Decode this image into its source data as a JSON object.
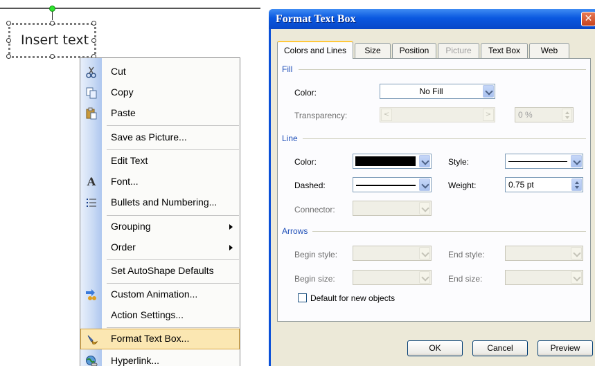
{
  "slide": {
    "textbox_text": "Insert text"
  },
  "context_menu": {
    "items": [
      {
        "label": "Cut",
        "icon": "scissors-icon"
      },
      {
        "label": "Copy",
        "icon": "copy-icon"
      },
      {
        "label": "Paste",
        "icon": "paste-icon"
      },
      {
        "label": "Save as Picture...",
        "icon": ""
      },
      {
        "label": "Edit Text",
        "icon": ""
      },
      {
        "label": "Font...",
        "icon": "font-icon"
      },
      {
        "label": "Bullets and Numbering...",
        "icon": "bullets-icon"
      },
      {
        "label": "Grouping",
        "icon": "",
        "submenu": true
      },
      {
        "label": "Order",
        "icon": "",
        "submenu": true
      },
      {
        "label": "Set AutoShape Defaults",
        "icon": ""
      },
      {
        "label": "Custom Animation...",
        "icon": "animation-icon"
      },
      {
        "label": "Action Settings...",
        "icon": ""
      },
      {
        "label": "Format Text Box...",
        "icon": "format-textbox-icon",
        "highlighted": true
      },
      {
        "label": "Hyperlink...",
        "icon": "hyperlink-icon"
      }
    ],
    "gutter_color": "#c9daf4",
    "highlight_color": "#fbe7b2"
  },
  "dialog": {
    "title": "Format Text Box",
    "close_glyph": "✕",
    "tabs": [
      {
        "label": "Colors and Lines",
        "active": true
      },
      {
        "label": "Size"
      },
      {
        "label": "Position"
      },
      {
        "label": "Picture",
        "disabled": true
      },
      {
        "label": "Text Box"
      },
      {
        "label": "Web"
      }
    ],
    "fill": {
      "group_label": "Fill",
      "color_label": "Color:",
      "color_value": "No Fill",
      "transparency_label": "Transparency:",
      "transparency_value": "0 %"
    },
    "line": {
      "group_label": "Line",
      "color_label": "Color:",
      "color_value": "#000000",
      "style_label": "Style:",
      "dashed_label": "Dashed:",
      "weight_label": "Weight:",
      "weight_value": "0.75 pt",
      "connector_label": "Connector:"
    },
    "arrows": {
      "group_label": "Arrows",
      "begin_style_label": "Begin style:",
      "end_style_label": "End style:",
      "begin_size_label": "Begin size:",
      "end_size_label": "End size:"
    },
    "default_checkbox_label": "Default for new objects",
    "default_checkbox_checked": false,
    "buttons": {
      "ok": "OK",
      "cancel": "Cancel",
      "preview": "Preview"
    },
    "title_bar_color": "#0a58e0",
    "face_color": "#ece9d8"
  }
}
